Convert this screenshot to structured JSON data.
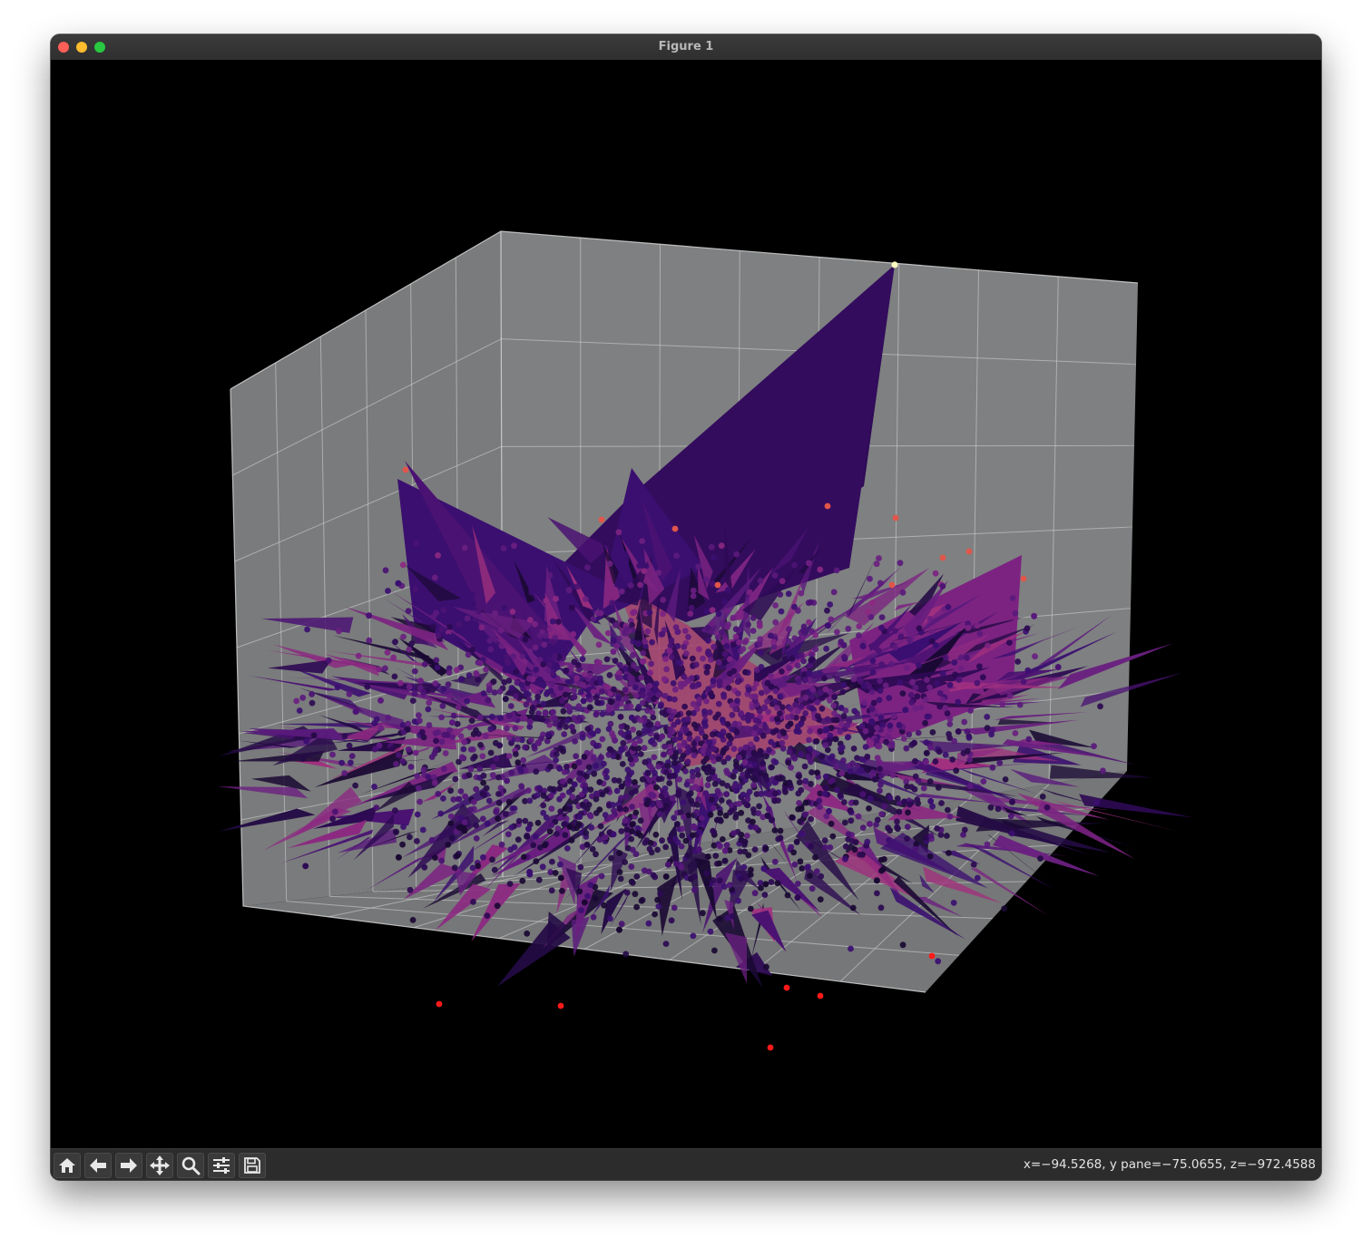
{
  "window": {
    "title": "Figure 1"
  },
  "toolbar": {
    "buttons": [
      {
        "name": "home-button",
        "icon": "home-icon"
      },
      {
        "name": "back-button",
        "icon": "arrow-left-icon"
      },
      {
        "name": "forward-button",
        "icon": "arrow-right-icon"
      },
      {
        "name": "pan-button",
        "icon": "move-arrows-icon"
      },
      {
        "name": "zoom-button",
        "icon": "magnifier-icon"
      },
      {
        "name": "configure-subplots-button",
        "icon": "sliders-icon"
      },
      {
        "name": "save-button",
        "icon": "floppy-disk-icon"
      }
    ],
    "coordinates": "x=−94.5268, y pane=−75.0655, z=−972.4588"
  },
  "chart_data": {
    "type": "scatter",
    "projection": "3d",
    "background": "#000000",
    "pane_color": "#7f8081",
    "grid": true,
    "colormap": "magma",
    "accent_colors": {
      "dark_purple": "#2d0a53",
      "purple": "#5a1a7c",
      "magenta": "#8c2981",
      "pink": "#b73779",
      "red_points": "#ff1a1a",
      "peak_point": "#fcfdbf"
    },
    "title": "",
    "xlabel": "",
    "ylabel": "",
    "zlabel": ""
  }
}
